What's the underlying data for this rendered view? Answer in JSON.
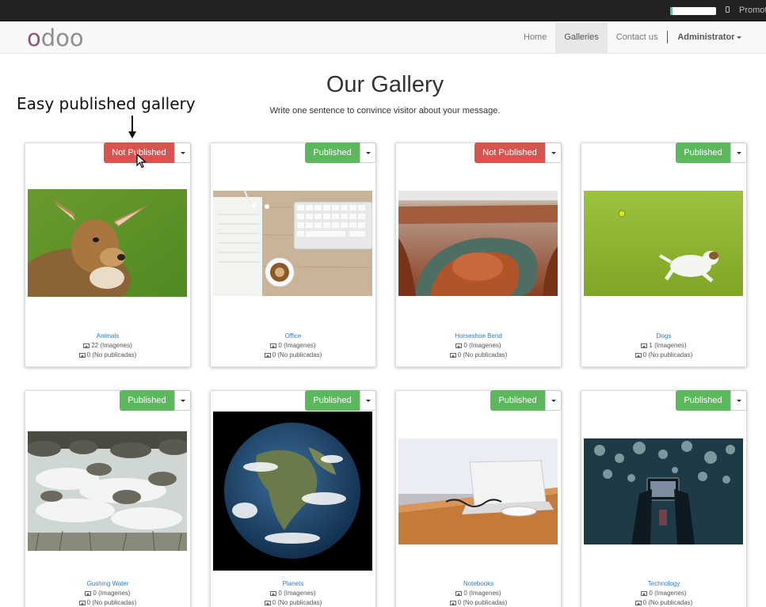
{
  "topbar": {
    "progress_fraction": 0.05,
    "promote_label": "Promot"
  },
  "navbar": {
    "logo_text": "odoo",
    "links": [
      {
        "label": "Home"
      },
      {
        "label": "Galleries",
        "active": true
      },
      {
        "label": "Contact us"
      }
    ],
    "user_label": "Administrator"
  },
  "page": {
    "title": "Our Gallery",
    "subtitle": "Write one sentence to convince visitor about your message."
  },
  "annotation": {
    "text": "Easy published gallery"
  },
  "colors": {
    "published": "#5cb85c",
    "not_published": "#d9534f",
    "link": "#337ab7"
  },
  "galleries": [
    {
      "name": "Animals",
      "status": "Not Published",
      "images": "22 (Imagenes)",
      "unpublished": "0 (No publicadas)",
      "image": "deer"
    },
    {
      "name": "Office",
      "status": "Published",
      "images": "0 (Imagenes)",
      "unpublished": "0 (No publicadas)",
      "image": "office"
    },
    {
      "name": "Horseshoe Bend",
      "status": "Not Published",
      "images": "0 (Imagenes)",
      "unpublished": "0 (No publicadas)",
      "image": "canyon"
    },
    {
      "name": "Dogs",
      "status": "Published",
      "images": "1 (Imagenes)",
      "unpublished": "0 (No publicadas)",
      "image": "dog"
    },
    {
      "name": "Gushing Water",
      "status": "Published",
      "images": "0 (Imagenes)",
      "unpublished": "0 (No publicadas)",
      "image": "water"
    },
    {
      "name": "Planets",
      "status": "Published",
      "images": "0 (Imagenes)",
      "unpublished": "0 (No publicadas)",
      "image": "earth"
    },
    {
      "name": "Notebooks",
      "status": "Published",
      "images": "0 (Imagenes)",
      "unpublished": "0 (No publicadas)",
      "image": "laptop"
    },
    {
      "name": "Technology",
      "status": "Published",
      "images": "0 (Imagenes)",
      "unpublished": "0 (No publicadas)",
      "image": "phone-lights"
    }
  ]
}
